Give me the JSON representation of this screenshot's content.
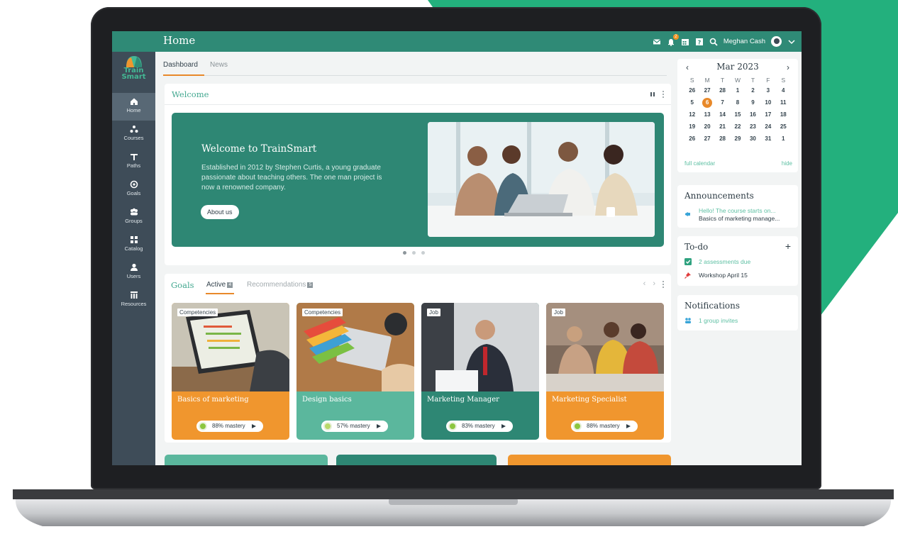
{
  "app": {
    "page_title": "Home",
    "brand": [
      "Train",
      "Smart"
    ],
    "user_name": "Meghan Cash",
    "notifications_badge": "2"
  },
  "sidebar": {
    "items": [
      {
        "label": "Home",
        "icon": "home-icon",
        "active": true
      },
      {
        "label": "Courses",
        "icon": "courses-icon"
      },
      {
        "label": "Paths",
        "icon": "paths-icon"
      },
      {
        "label": "Goals",
        "icon": "goals-icon"
      },
      {
        "label": "Groups",
        "icon": "groups-icon"
      },
      {
        "label": "Catalog",
        "icon": "catalog-icon"
      },
      {
        "label": "Users",
        "icon": "users-icon"
      },
      {
        "label": "Resources",
        "icon": "resources-icon"
      }
    ]
  },
  "tabs": [
    {
      "label": "Dashboard",
      "active": true
    },
    {
      "label": "News"
    }
  ],
  "welcome": {
    "card_title": "Welcome",
    "hero_title": "Welcome to TrainSmart",
    "hero_text": "Established in 2012 by Stephen Curtis, a young graduate passionate about teaching others. The one man project is now a renowned company.",
    "button_label": "About us",
    "slides": 3,
    "active_slide": 0
  },
  "goals": {
    "title": "Goals",
    "tabs": [
      {
        "label": "Active",
        "count": "4"
      },
      {
        "label": "Recommendations",
        "count": "5"
      }
    ],
    "cards": [
      {
        "tag": "Competencies",
        "name": "Basics of marketing",
        "mastery": "88% mastery",
        "color": "#f0962e"
      },
      {
        "tag": "Competencies",
        "name": "Design basics",
        "mastery": "57% mastery",
        "color": "#5bb79d"
      },
      {
        "tag": "Job",
        "name": "Marketing Manager",
        "mastery": "83% mastery",
        "color": "#2e8774"
      },
      {
        "tag": "Job",
        "name": "Marketing Specialist",
        "mastery": "88% mastery",
        "color": "#f0962e"
      }
    ]
  },
  "calendar": {
    "month": "Mar 2023",
    "weekdays": [
      "S",
      "M",
      "T",
      "W",
      "T",
      "F",
      "S"
    ],
    "weeks": [
      [
        "26",
        "27",
        "28",
        "1",
        "2",
        "3",
        "4"
      ],
      [
        "5",
        "6",
        "7",
        "8",
        "9",
        "10",
        "11"
      ],
      [
        "12",
        "13",
        "14",
        "15",
        "16",
        "17",
        "18"
      ],
      [
        "19",
        "20",
        "21",
        "22",
        "23",
        "24",
        "25"
      ],
      [
        "26",
        "27",
        "28",
        "29",
        "30",
        "31",
        "1"
      ]
    ],
    "today": "6",
    "full_calendar": "full calendar",
    "hide": "hide"
  },
  "announcements": {
    "title": "Announcements",
    "line1": "Hello! The course starts on...",
    "line2": "Basics of marketing manage..."
  },
  "todo": {
    "title": "To-do",
    "items": [
      "2 assessments due",
      "Workshop April 15"
    ]
  },
  "notifications": {
    "title": "Notifications",
    "item": "1 group invites"
  },
  "colors": {
    "brand_green": "#2f8a76",
    "accent_orange": "#e8892a",
    "sidebar": "#3e4c58",
    "backdrop_green": "#23b07d"
  }
}
